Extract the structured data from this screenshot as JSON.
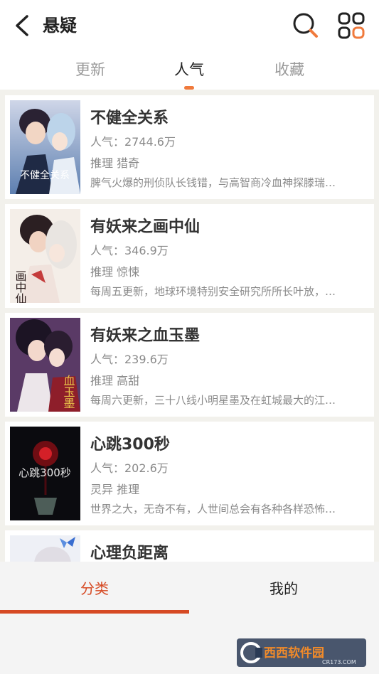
{
  "header": {
    "title": "悬疑",
    "tabs": [
      {
        "label": "更新"
      },
      {
        "label": "人气"
      },
      {
        "label": "收藏"
      }
    ],
    "active_tab": 1
  },
  "icons": {
    "back": "chevron-left-icon",
    "search": "search-icon",
    "menu": "grid-icon"
  },
  "colors": {
    "accent": "#f07a3c",
    "nav_active": "#d64a24",
    "background": "#f2f1ec"
  },
  "comics": [
    {
      "title": "不健全关系",
      "popularity": "人气：2744.6万",
      "tags": "推理 猎奇",
      "desc": "脾气火爆的刑侦队长钱错，与高智商冷血神探滕瑞…",
      "cover_text": "不健全关系"
    },
    {
      "title": "有妖来之画中仙",
      "popularity": "人气：346.9万",
      "tags": "推理 惊悚",
      "desc": "每周五更新，地球环境特别安全研究所所长叶放，…",
      "cover_text": "画中仙"
    },
    {
      "title": "有妖来之血玉墨",
      "popularity": "人气：239.6万",
      "tags": "推理 高甜",
      "desc": "每周六更新，三十八线小明星墨及在虹城最大的江…",
      "cover_text": "血玉墨"
    },
    {
      "title": "心跳300秒",
      "popularity": "人气：202.6万",
      "tags": "灵异 推理",
      "desc": "世界之大，无奇不有，人世间总会有各种各样恐怖…",
      "cover_text": "心跳300秒"
    },
    {
      "title": "心理负距离",
      "popularity": "",
      "tags": "",
      "desc": "",
      "cover_text": ""
    }
  ],
  "bottom_nav": [
    {
      "label": "分类"
    },
    {
      "label": "我的"
    }
  ],
  "watermark": {
    "brand": "西西软件园",
    "domain": "CR173.COM"
  }
}
